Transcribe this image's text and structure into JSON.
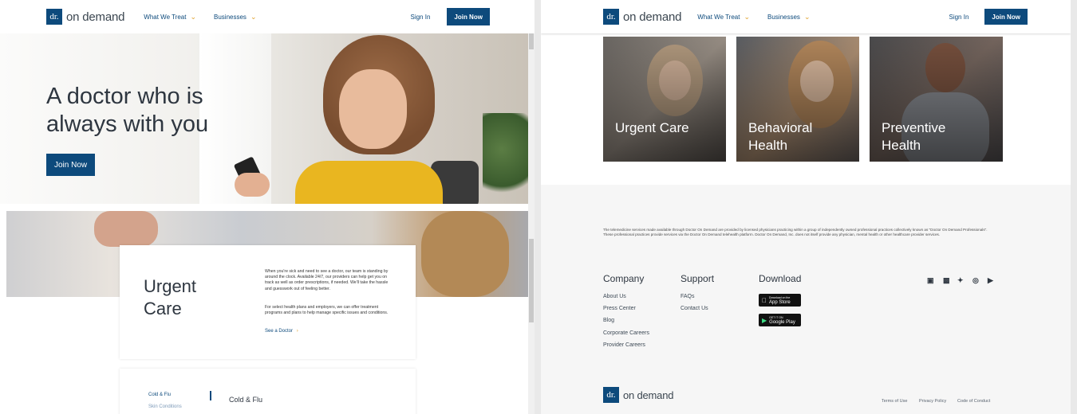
{
  "brand": {
    "logo_mark": "dr.",
    "logo_text": "on demand",
    "color": "#0d4a7c",
    "accent": "#e0a028"
  },
  "nav": {
    "what_we_treat": "What We Treat",
    "businesses": "Businesses",
    "sign_in": "Sign In",
    "join_now": "Join Now"
  },
  "hero": {
    "title": "A doctor who is always with you",
    "cta": "Join Now"
  },
  "urgent": {
    "title": "Urgent Care",
    "p1": "When you're sick and need to see a doctor, our team is standing by around the clock. Available 24/7, our providers can help get you on track as well as order prescriptions, if needed. We'll take the hassle and guesswork out of feeling better.",
    "p2": "For select health plans and employers, we can offer treatment programs and plans to help manage specific issues and conditions.",
    "link": "See a Doctor"
  },
  "conditions": {
    "selected": "Cold & Flu",
    "next_item": "Skin Conditions",
    "content_title": "Cold & Flu"
  },
  "tiles": [
    "Urgent Care",
    "Behavioral Health",
    "Preventive Health"
  ],
  "footer": {
    "disclaimer": "The telemedicine services made available through Doctor On Demand are provided by licensed physicians practicing within a group of independently owned professional practices collectively known as \"Doctor On Demand Professionals\". These professional practices provide services via the Doctor On Demand telehealth platform. Doctor On Demand, Inc. does not itself provide any physician, mental health or other healthcare provider services.",
    "company": {
      "heading": "Company",
      "links": [
        "About Us",
        "Press Center",
        "Blog",
        "Corporate Careers",
        "Provider Careers"
      ]
    },
    "support": {
      "heading": "Support",
      "links": [
        "FAQs",
        "Contact Us"
      ]
    },
    "download": {
      "heading": "Download",
      "app_store_small": "Download on the",
      "app_store": "App Store",
      "google_small": "GET IT ON",
      "google": "Google Play"
    },
    "social_icons": [
      "facebook-icon",
      "linkedin-icon",
      "twitter-icon",
      "instagram-icon",
      "youtube-icon"
    ],
    "legal": [
      "Terms of Use",
      "Privacy Policy",
      "Code of Conduct"
    ]
  }
}
